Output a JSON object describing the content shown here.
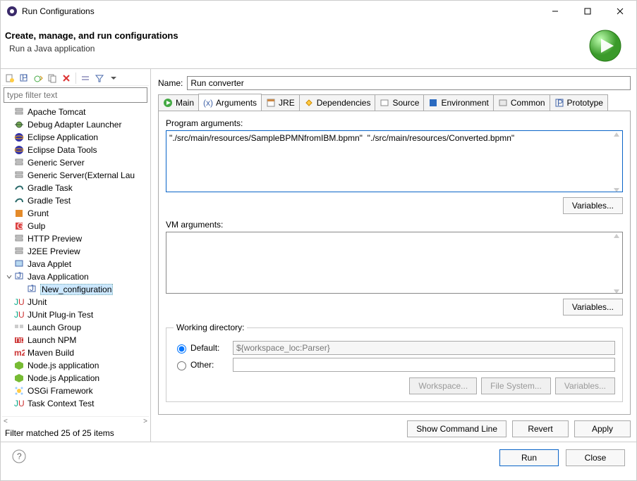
{
  "window": {
    "title": "Run Configurations"
  },
  "header": {
    "title": "Create, manage, and run configurations",
    "subtitle": "Run a Java application"
  },
  "left": {
    "filter_placeholder": "type filter text",
    "status": "Filter matched 25 of 25 items",
    "items": [
      {
        "label": "Apache Tomcat",
        "icon": "server"
      },
      {
        "label": "Debug Adapter Launcher",
        "icon": "bug"
      },
      {
        "label": "Eclipse Application",
        "icon": "eclipse"
      },
      {
        "label": "Eclipse Data Tools",
        "icon": "eclipse"
      },
      {
        "label": "Generic Server",
        "icon": "server"
      },
      {
        "label": "Generic Server(External Lau",
        "icon": "server"
      },
      {
        "label": "Gradle Task",
        "icon": "gradle"
      },
      {
        "label": "Gradle Test",
        "icon": "gradle"
      },
      {
        "label": "Grunt",
        "icon": "grunt"
      },
      {
        "label": "Gulp",
        "icon": "gulp"
      },
      {
        "label": "HTTP Preview",
        "icon": "server"
      },
      {
        "label": "J2EE Preview",
        "icon": "server"
      },
      {
        "label": "Java Applet",
        "icon": "applet"
      },
      {
        "label": "Java Application",
        "icon": "java",
        "expanded": true,
        "children": [
          {
            "label": "New_configuration",
            "icon": "java",
            "selected": true
          }
        ]
      },
      {
        "label": "JUnit",
        "icon": "junit"
      },
      {
        "label": "JUnit Plug-in Test",
        "icon": "junitp"
      },
      {
        "label": "Launch Group",
        "icon": "group"
      },
      {
        "label": "Launch NPM",
        "icon": "npm"
      },
      {
        "label": "Maven Build",
        "icon": "maven"
      },
      {
        "label": "Node.js application",
        "icon": "node"
      },
      {
        "label": "Node.js Application",
        "icon": "node"
      },
      {
        "label": "OSGi Framework",
        "icon": "osgi"
      },
      {
        "label": "Task Context Test",
        "icon": "junit"
      }
    ]
  },
  "form": {
    "name_label": "Name:",
    "name_value": "Run converter",
    "tabs": [
      {
        "id": "main",
        "label": "Main"
      },
      {
        "id": "arguments",
        "label": "Arguments",
        "active": true
      },
      {
        "id": "jre",
        "label": "JRE"
      },
      {
        "id": "deps",
        "label": "Dependencies"
      },
      {
        "id": "source",
        "label": "Source"
      },
      {
        "id": "env",
        "label": "Environment"
      },
      {
        "id": "common",
        "label": "Common"
      },
      {
        "id": "proto",
        "label": "Prototype"
      }
    ],
    "program_args_label": "Program arguments:",
    "program_args_value": "\"./src/main/resources/SampleBPMNfromIBM.bpmn\"  \"./src/main/resources/Converted.bpmn\"",
    "vm_args_label": "VM arguments:",
    "vm_args_value": "",
    "variables_btn": "Variables...",
    "wd_legend": "Working directory:",
    "wd_default_label": "Default:",
    "wd_default_value": "${workspace_loc:Parser}",
    "wd_other_label": "Other:",
    "wd_other_value": "",
    "workspace_btn": "Workspace...",
    "filesystem_btn": "File System...",
    "show_cmd_btn": "Show Command Line",
    "revert_btn": "Revert",
    "apply_btn": "Apply"
  },
  "footer": {
    "run_btn": "Run",
    "close_btn": "Close"
  }
}
